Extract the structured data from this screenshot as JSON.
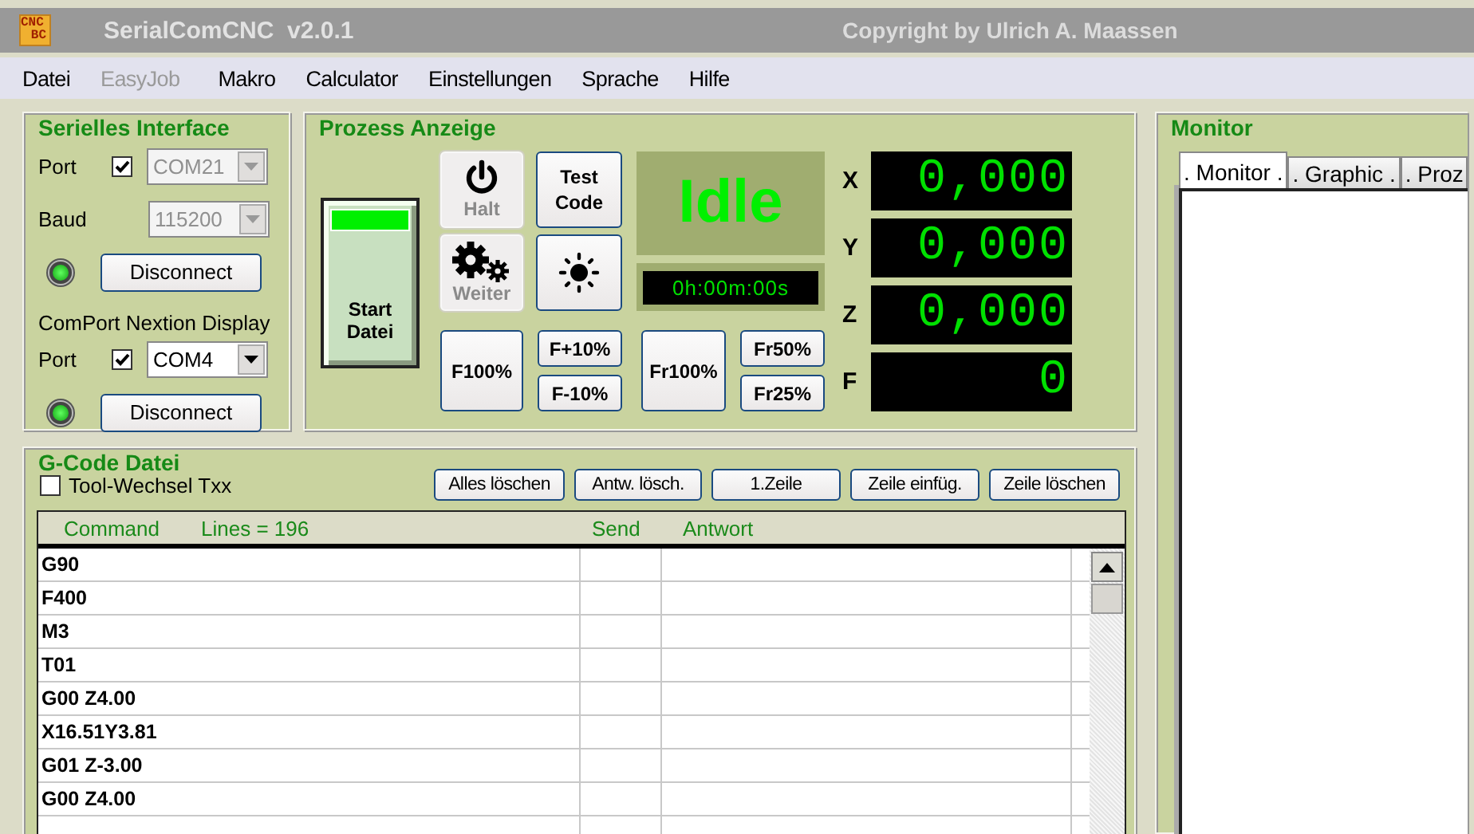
{
  "window": {
    "title": "SerialComCNC  v2.0.1",
    "copyright": "Copyright by Ulrich A. Maassen",
    "app_icon": [
      "CNC",
      "BC"
    ]
  },
  "menu": [
    {
      "label": "Datei",
      "disabled": false
    },
    {
      "label": "EasyJob",
      "disabled": true
    },
    {
      "label": "Makro",
      "disabled": false
    },
    {
      "label": "Calculator",
      "disabled": false
    },
    {
      "label": "Einstellungen",
      "disabled": false
    },
    {
      "label": "Sprache",
      "disabled": false
    },
    {
      "label": "Hilfe",
      "disabled": false
    }
  ],
  "serial": {
    "title": "Serielles Interface",
    "port_label": "Port",
    "port_checked": true,
    "port_value": "COM21",
    "port_disabled": true,
    "baud_label": "Baud",
    "baud_value": "115200",
    "baud_disabled": true,
    "connected": true,
    "button": "Disconnect"
  },
  "nextion": {
    "title": "ComPort Nextion Display",
    "port_label": "Port",
    "port_checked": true,
    "port_value": "COM4",
    "port_disabled": false,
    "connected": true,
    "button": "Disconnect"
  },
  "process": {
    "title": "Prozess Anzeige",
    "start": "Start Datei",
    "status": "Idle",
    "timer": "0h:00m:00s",
    "controls": [
      {
        "label": "Halt",
        "disabled": true
      },
      {
        "label": "Test Code",
        "disabled": false
      },
      {
        "label": "Weiter",
        "disabled": true
      },
      {
        "disabled": false
      }
    ],
    "feed": [
      "F100%",
      "F+10%",
      "F-10%",
      "Fr100%",
      "Fr50%",
      "Fr25%"
    ],
    "axes": [
      {
        "axis": "X",
        "value": "0,000"
      },
      {
        "axis": "Y",
        "value": "0,000"
      },
      {
        "axis": "Z",
        "value": "0,000"
      },
      {
        "axis": "F",
        "value": "0"
      }
    ]
  },
  "monitor": {
    "title": "Monitor",
    "tabs": [
      {
        "label": ". Monitor .",
        "selected": true
      },
      {
        "label": ". Graphic .",
        "selected": false
      },
      {
        "label": ". Proz",
        "selected": false
      }
    ]
  },
  "gcode": {
    "title": "G-Code Datei",
    "tool_change": {
      "label": "Tool-Wechsel Txx",
      "checked": false
    },
    "buttons": [
      "Alles löschen",
      "Antw. lösch.",
      "1.Zeile",
      "Zeile einfüg.",
      "Zeile löschen"
    ],
    "columns": [
      "Command",
      "Lines = 196",
      "Send",
      "Antwort"
    ],
    "rows": [
      "G90",
      "F400",
      "M3",
      "T01",
      "G00 Z4.00",
      "X16.51Y3.81",
      "G01 Z-3.00",
      "G00 Z4.00"
    ]
  }
}
